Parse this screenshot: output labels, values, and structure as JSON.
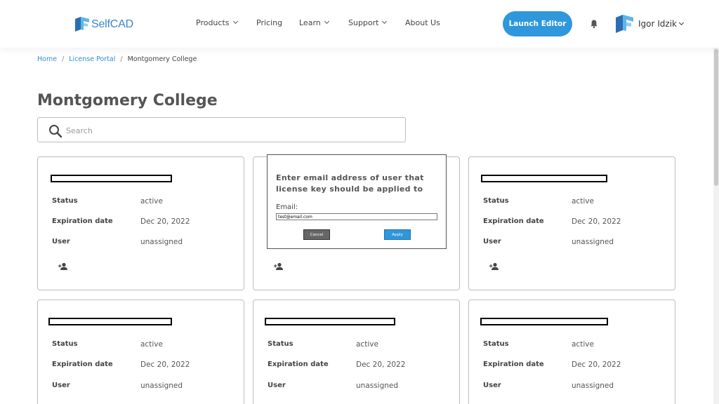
{
  "header": {
    "logo_text": "SelfCAD",
    "nav": [
      {
        "label": "Products"
      },
      {
        "label": "Pricing"
      },
      {
        "label": "Learn"
      },
      {
        "label": "Support"
      },
      {
        "label": "About Us"
      }
    ],
    "launch_label": "Launch Editor",
    "user_name": "Igor Idzik"
  },
  "breadcrumb": {
    "home": "Home",
    "portal": "License Portal",
    "current": "Montgomery College",
    "separator": "/"
  },
  "page_title": "Montgomery College",
  "search": {
    "placeholder": "Search",
    "value": ""
  },
  "card_labels": {
    "status": "Status",
    "expiration": "Expiration date",
    "user": "User"
  },
  "cards": [
    {
      "status": "active",
      "expiration": "Dec 20, 2022",
      "user": "unassigned"
    },
    {
      "status": "active",
      "expiration": "Dec 20, 2022",
      "user": "unassigned"
    },
    {
      "status": "active",
      "expiration": "Dec 20, 2022",
      "user": "unassigned"
    },
    {
      "status": "active",
      "expiration": "Dec 20, 2022",
      "user": "unassigned"
    },
    {
      "status": "active",
      "expiration": "Dec 20, 2022",
      "user": "unassigned"
    },
    {
      "status": "active",
      "expiration": "Dec 20, 2022",
      "user": "unassigned"
    }
  ],
  "modal": {
    "title": "Enter email address of user that license key should be applied to",
    "email_label": "Email:",
    "email_value": "test@email.com",
    "cancel_label": "Cancel",
    "apply_label": "Apply"
  },
  "colors": {
    "accent": "#2f97db",
    "link": "#2f8fd0",
    "cancel": "#666666"
  }
}
